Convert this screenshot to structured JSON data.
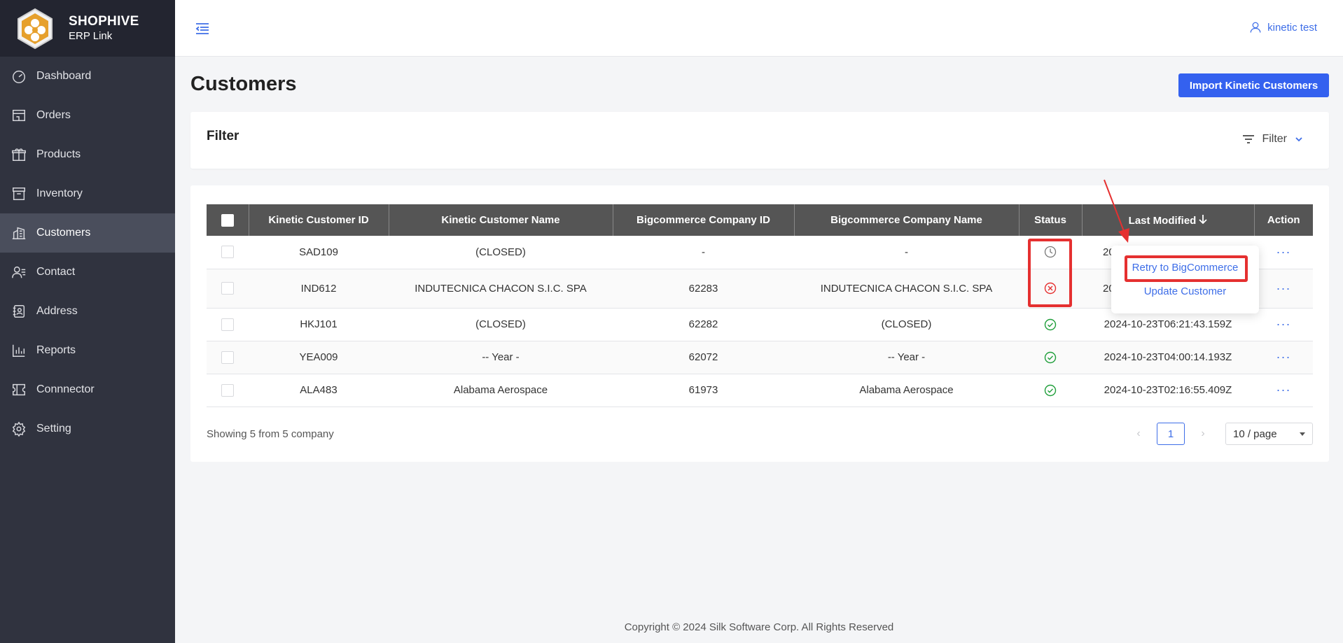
{
  "brand": {
    "title": "SHOPHIVE",
    "subtitle": "ERP Link"
  },
  "sidebar": {
    "items": [
      {
        "label": "Dashboard",
        "icon": "dashboard-icon"
      },
      {
        "label": "Orders",
        "icon": "store-icon"
      },
      {
        "label": "Products",
        "icon": "gift-icon"
      },
      {
        "label": "Inventory",
        "icon": "archive-icon"
      },
      {
        "label": "Customers",
        "icon": "buildings-icon",
        "active": true
      },
      {
        "label": "Contact",
        "icon": "contact-icon"
      },
      {
        "label": "Address",
        "icon": "address-book-icon"
      },
      {
        "label": "Reports",
        "icon": "bar-chart-icon"
      },
      {
        "label": "Connnector",
        "icon": "connector-icon"
      },
      {
        "label": "Setting",
        "icon": "gear-icon"
      }
    ]
  },
  "header": {
    "user_name": "kinetic test"
  },
  "page": {
    "title": "Customers",
    "import_button": "Import Kinetic Customers"
  },
  "filter": {
    "title": "Filter",
    "toggle_label": "Filter"
  },
  "table": {
    "headers": [
      "Kinetic Customer ID",
      "Kinetic Customer Name",
      "Bigcommerce Company ID",
      "Bigcommerce Company Name",
      "Status",
      "Last Modified",
      "Action"
    ],
    "rows": [
      {
        "kinetic_id": "SAD109",
        "kinetic_name": "(CLOSED)",
        "bc_id": "-",
        "bc_name": "-",
        "status": "pending",
        "last_modified": "20",
        "action": "···"
      },
      {
        "kinetic_id": "IND612",
        "kinetic_name": "INDUTECNICA CHACON S.I.C. SPA",
        "bc_id": "62283",
        "bc_name": "INDUTECNICA CHACON S.I.C. SPA",
        "status": "error",
        "last_modified": "20",
        "action": "···"
      },
      {
        "kinetic_id": "HKJ101",
        "kinetic_name": "(CLOSED)",
        "bc_id": "62282",
        "bc_name": "(CLOSED)",
        "status": "success",
        "last_modified": "2024-10-23T06:21:43.159Z",
        "action": "···"
      },
      {
        "kinetic_id": "YEA009",
        "kinetic_name": "-- Year -",
        "bc_id": "62072",
        "bc_name": "-- Year -",
        "status": "success",
        "last_modified": "2024-10-23T04:00:14.193Z",
        "action": "···"
      },
      {
        "kinetic_id": "ALA483",
        "kinetic_name": "Alabama Aerospace",
        "bc_id": "61973",
        "bc_name": "Alabama Aerospace",
        "status": "success",
        "last_modified": "2024-10-23T02:16:55.409Z",
        "action": "···"
      }
    ],
    "showing": "Showing 5 from 5 company"
  },
  "pagination": {
    "current_page": "1",
    "page_size": "10 / page"
  },
  "popover": {
    "retry": "Retry to BigCommerce",
    "update": "Update Customer"
  },
  "colors": {
    "accent": "#3461ef",
    "sidebar": "#30333f",
    "success": "#1f9e3a",
    "error": "#e53030",
    "annotation": "#e53030"
  },
  "footer": {
    "copyright": "Copyright © 2024 Silk Software Corp. All Rights Reserved"
  }
}
